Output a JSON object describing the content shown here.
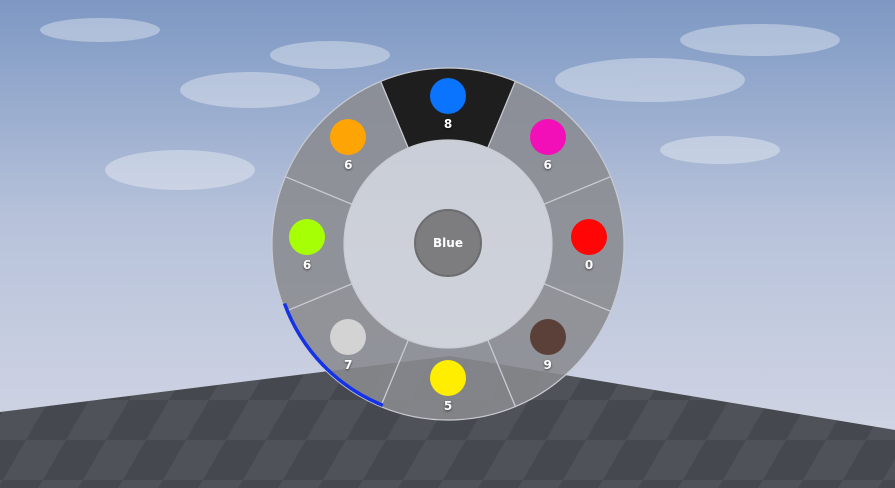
{
  "selection": {
    "label": "Blue",
    "selected_slot": 0
  },
  "slots": [
    {
      "name": "blue",
      "color": "#0a74ff",
      "count": "8"
    },
    {
      "name": "magenta",
      "color": "#f20fb7",
      "count": "6"
    },
    {
      "name": "red",
      "color": "#ff0505",
      "count": "0"
    },
    {
      "name": "brown",
      "color": "#5b403a",
      "count": "9"
    },
    {
      "name": "yellow",
      "color": "#ffee00",
      "count": "5"
    },
    {
      "name": "white",
      "color": "#d3d3d3",
      "count": "7"
    },
    {
      "name": "lime",
      "color": "#a6ff05",
      "count": "6"
    },
    {
      "name": "orange",
      "color": "#ffa405",
      "count": "6"
    }
  ],
  "colors": {
    "segment_fill": "#8a8b90",
    "segment_selected": "#1e1e1f",
    "center_fill": "#d0d2d8",
    "progress_arc": "#1433e8"
  }
}
